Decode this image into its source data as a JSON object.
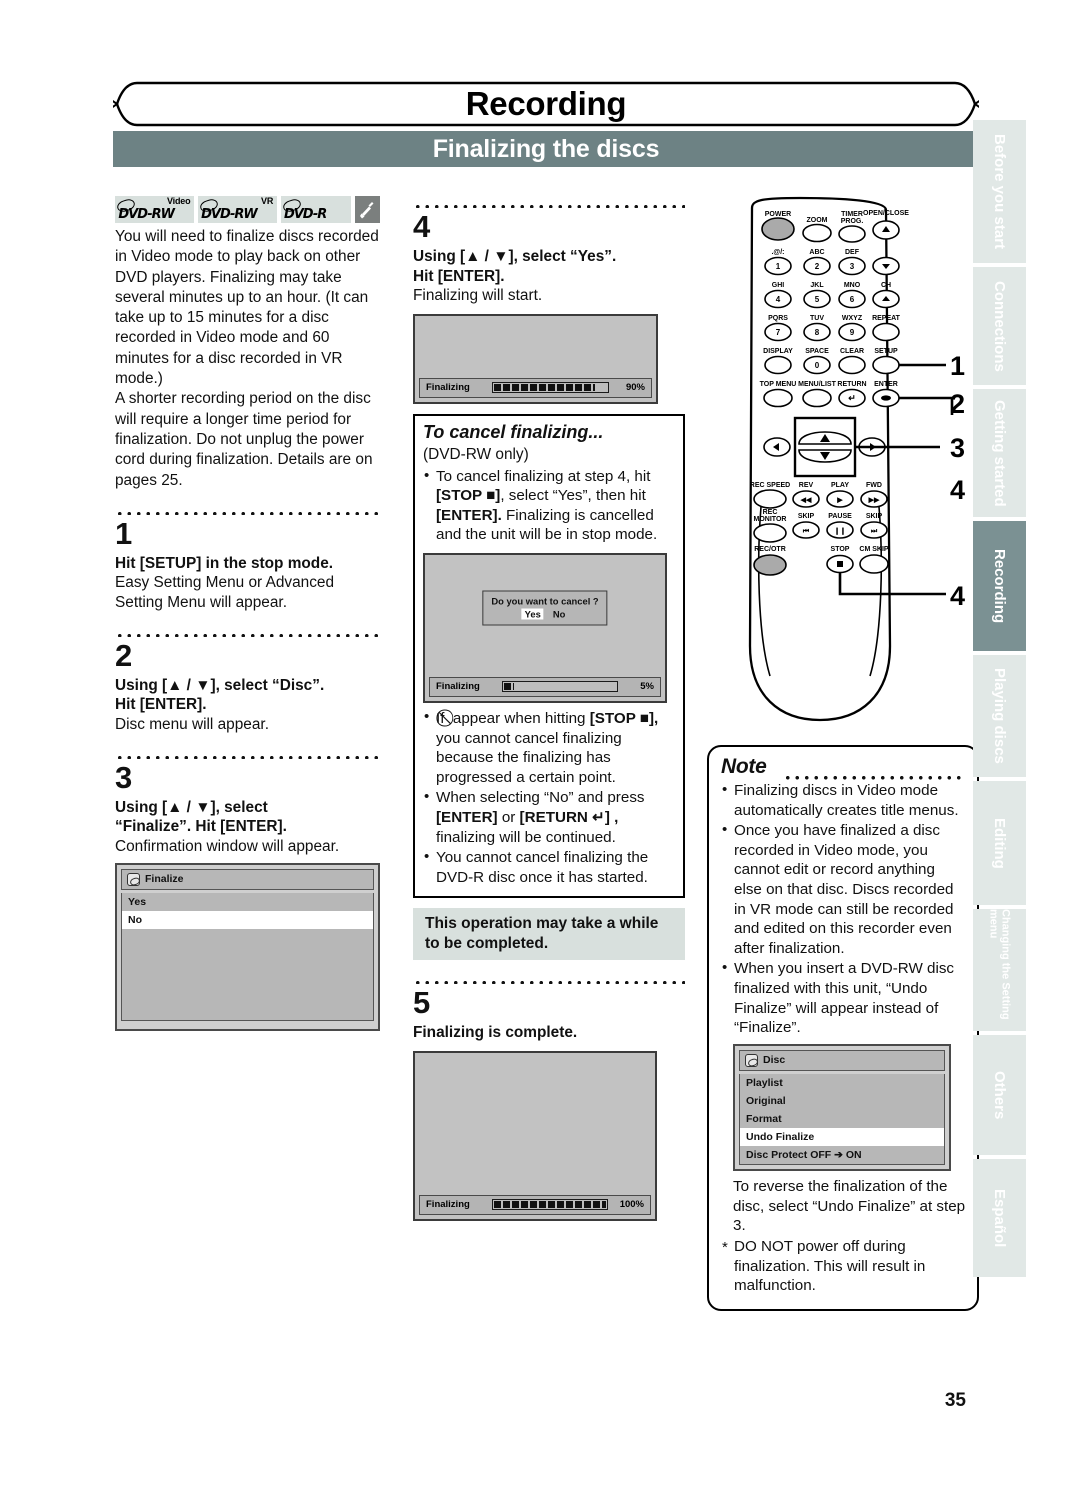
{
  "header": {
    "chapter_title": "Recording",
    "section_title": "Finalizing the discs"
  },
  "page_number": "35",
  "side_tabs": [
    {
      "label": "Before you start",
      "active": false
    },
    {
      "label": "Connections",
      "active": false
    },
    {
      "label": "Getting started",
      "active": false
    },
    {
      "label": "Recording",
      "active": true
    },
    {
      "label": "Playing discs",
      "active": false
    },
    {
      "label": "Editing",
      "active": false
    },
    {
      "label": "Changing the Setting menu",
      "active": false
    },
    {
      "label": "Others",
      "active": false
    },
    {
      "label": "Español",
      "active": false
    }
  ],
  "badges": [
    {
      "sup": "Video",
      "main": "DVD-RW"
    },
    {
      "sup": "VR",
      "main": "DVD-RW"
    },
    {
      "sup": "",
      "main": "DVD-R"
    }
  ],
  "intro": {
    "p1": "You will need to finalize discs recorded in Video mode to play back on other DVD players. Finalizing may take several minutes up to an hour. (It can take up to 15 minutes for a disc recorded in Video mode and 60 minutes for a disc recorded in VR mode.)",
    "p2": "A shorter recording period on the disc will require a longer time period for finalization. Do not unplug the power cord during finalization. Details are on pages 25."
  },
  "steps": {
    "step1": {
      "number": "1",
      "heading": "Hit [SETUP] in the stop mode.",
      "sub": "Easy Setting Menu or Advanced Setting Menu will appear."
    },
    "step2": {
      "number": "2",
      "heading_a": "Using [▲ / ▼], select “Disc”.",
      "heading_b": "Hit [ENTER].",
      "sub": "Disc menu will appear."
    },
    "step3": {
      "number": "3",
      "heading_a": "Using [▲ / ▼], select",
      "heading_b": "“Finalize”. Hit [ENTER].",
      "sub": "Confirmation window will appear."
    },
    "step4": {
      "number": "4",
      "heading_a": "Using [▲ / ▼], select “Yes”.",
      "heading_b": "Hit [ENTER].",
      "sub": "Finalizing will start."
    },
    "step5": {
      "number": "5",
      "heading": "Finalizing is complete."
    }
  },
  "finalize_menu": {
    "title": "Finalize",
    "items": [
      {
        "label": "Yes",
        "selected": false
      },
      {
        "label": "No",
        "selected": true
      }
    ]
  },
  "osd_step4": {
    "label": "Finalizing",
    "percent": "90%",
    "fill": 90
  },
  "osd_cancel": {
    "label": "Finalizing",
    "percent": "5%",
    "fill": 6,
    "dialog_question": "Do you want to cancel ?",
    "dialog_yes": "Yes",
    "dialog_no": "No"
  },
  "osd_step5": {
    "label": "Finalizing",
    "percent": "100%",
    "fill": 100
  },
  "cancel_box": {
    "title": "To cancel finalizing...",
    "subtitle": "(DVD-RW only)",
    "bullet1_a": "To cancel finalizing at step 4, hit ",
    "bullet1_b": "[STOP ■]",
    "bullet1_c": ", select “Yes”, then hit ",
    "bullet1_d": "[ENTER].",
    "bullet1_e": " Finalizing is cancelled and the unit will be in stop mode.",
    "bullet2_a": "If ",
    "bullet2_icon": "⃠",
    "bullet2_b": " appear when hitting ",
    "bullet2_c": "[STOP ■],",
    "bullet2_d": " you cannot cancel finalizing because the finalizing has progressed a certain point.",
    "bullet3_a": "When selecting “No” and press ",
    "bullet3_b": "[ENTER]",
    "bullet3_c": " or ",
    "bullet3_d": "[RETURN ↵] ,",
    "bullet3_e": " finalizing will be continued.",
    "bullet4": "You cannot cancel finalizing the DVD-R disc once it has started."
  },
  "highlight": {
    "text": "This operation may take a while to be completed."
  },
  "note": {
    "title": "Note",
    "bullet1": "Finalizing discs in Video mode automatically creates title menus.",
    "bullet2": "Once you have finalized a disc recorded in Video mode, you cannot edit or record anything else on that disc. Discs recorded in VR mode can still be recorded and edited on this recorder even after finalization.",
    "bullet3": "When you insert a DVD-RW disc finalized with this unit, “Undo Finalize” will appear instead of “Finalize”.",
    "after_menu": "To reverse the finalization of the disc, select “Undo Finalize” at step 3.",
    "bullet4": "DO NOT power off during finalization. This will result in malfunction."
  },
  "disc_menu": {
    "title": "Disc",
    "items": [
      {
        "label": "Playlist",
        "selected": false
      },
      {
        "label": "Original",
        "selected": false
      },
      {
        "label": "Format",
        "selected": false
      },
      {
        "label": "Undo Finalize",
        "selected": true
      },
      {
        "label": "Disc Protect OFF ➔ ON",
        "selected": false
      }
    ]
  },
  "remote": {
    "callouts": [
      "1",
      "2",
      "3",
      "4",
      "4"
    ],
    "buttons": [
      {
        "label": "POWER"
      },
      {
        "label": "ZOOM"
      },
      {
        "label": "TIMER PROG."
      },
      {
        "label": "OPEN/CLOSE"
      },
      {
        "label": ".@/:",
        "digit": "1"
      },
      {
        "label": "ABC",
        "digit": "2"
      },
      {
        "label": "DEF",
        "digit": "3"
      },
      {
        "label": "GHI",
        "digit": "4"
      },
      {
        "label": "JKL",
        "digit": "5"
      },
      {
        "label": "MNO",
        "digit": "6"
      },
      {
        "label": "CH"
      },
      {
        "label": "PQRS",
        "digit": "7"
      },
      {
        "label": "TUV",
        "digit": "8"
      },
      {
        "label": "WXYZ",
        "digit": "9"
      },
      {
        "label": "REPEAT"
      },
      {
        "label": "DISPLAY"
      },
      {
        "label": "SPACE",
        "digit": "0"
      },
      {
        "label": "CLEAR"
      },
      {
        "label": "SETUP"
      },
      {
        "label": "TOP MENU"
      },
      {
        "label": "MENU/LIST"
      },
      {
        "label": "RETURN"
      },
      {
        "label": "ENTER"
      },
      {
        "label": "REC SPEED"
      },
      {
        "label": "REV"
      },
      {
        "label": "PLAY"
      },
      {
        "label": "FWD"
      },
      {
        "label": "REC MONITOR"
      },
      {
        "label": "SKIP"
      },
      {
        "label": "PAUSE"
      },
      {
        "label": "SKIP"
      },
      {
        "label": "REC/OTR"
      },
      {
        "label": "STOP"
      },
      {
        "label": "CM SKIP"
      }
    ]
  }
}
